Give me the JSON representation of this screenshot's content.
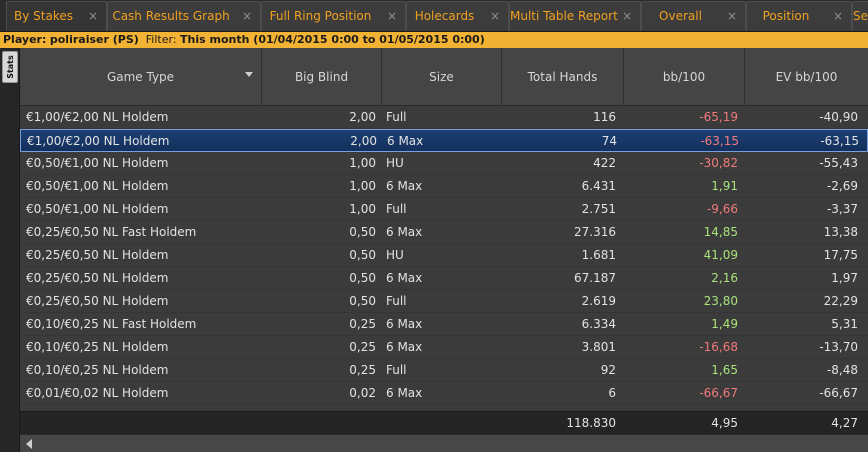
{
  "tabs": [
    {
      "label": "By Stakes",
      "close": "×"
    },
    {
      "label": "Cash Results Graph",
      "close": "×"
    },
    {
      "label": "Full Ring Position",
      "close": "×"
    },
    {
      "label": "Holecards",
      "close": "×"
    },
    {
      "label": "Multi Table Report",
      "close": "×"
    },
    {
      "label": "Overall",
      "close": "×"
    },
    {
      "label": "Position",
      "close": "×"
    },
    {
      "label": "Se",
      "close": ""
    }
  ],
  "filter": {
    "player_label": "Player:",
    "player_value": "poliraiser (PS)",
    "filter_label": "Filter:",
    "filter_value": "This month (01/04/2015 0:00 to 01/05/2015 0:00)"
  },
  "side_tab": "Stats",
  "columns": [
    "Game Type",
    "Big Blind",
    "Size",
    "Total Hands",
    "bb/100",
    "EV bb/100"
  ],
  "rows": [
    {
      "game": "€1,00/€2,00 NL Holdem",
      "bb": "2,00",
      "size": "Full",
      "hands": "116",
      "bb100": "-65,19",
      "ev": "-40,90",
      "sign": "neg"
    },
    {
      "game": "€1,00/€2,00 NL Holdem",
      "bb": "2,00",
      "size": "6 Max",
      "hands": "74",
      "bb100": "-63,15",
      "ev": "-63,15",
      "sign": "neg"
    },
    {
      "game": "€0,50/€1,00 NL Holdem",
      "bb": "1,00",
      "size": "HU",
      "hands": "422",
      "bb100": "-30,82",
      "ev": "-55,43",
      "sign": "neg"
    },
    {
      "game": "€0,50/€1,00 NL Holdem",
      "bb": "1,00",
      "size": "6 Max",
      "hands": "6.431",
      "bb100": "1,91",
      "ev": "-2,69",
      "sign": "pos"
    },
    {
      "game": "€0,50/€1,00 NL Holdem",
      "bb": "1,00",
      "size": "Full",
      "hands": "2.751",
      "bb100": "-9,66",
      "ev": "-3,37",
      "sign": "neg"
    },
    {
      "game": "€0,25/€0,50 NL Fast Holdem",
      "bb": "0,50",
      "size": "6 Max",
      "hands": "27.316",
      "bb100": "14,85",
      "ev": "13,38",
      "sign": "pos"
    },
    {
      "game": "€0,25/€0,50 NL Holdem",
      "bb": "0,50",
      "size": "HU",
      "hands": "1.681",
      "bb100": "41,09",
      "ev": "17,75",
      "sign": "pos"
    },
    {
      "game": "€0,25/€0,50 NL Holdem",
      "bb": "0,50",
      "size": "6 Max",
      "hands": "67.187",
      "bb100": "2,16",
      "ev": "1,97",
      "sign": "pos"
    },
    {
      "game": "€0,25/€0,50 NL Holdem",
      "bb": "0,50",
      "size": "Full",
      "hands": "2.619",
      "bb100": "23,80",
      "ev": "22,29",
      "sign": "pos"
    },
    {
      "game": "€0,10/€0,25 NL Fast Holdem",
      "bb": "0,25",
      "size": "6 Max",
      "hands": "6.334",
      "bb100": "1,49",
      "ev": "5,31",
      "sign": "pos"
    },
    {
      "game": "€0,10/€0,25 NL Holdem",
      "bb": "0,25",
      "size": "6 Max",
      "hands": "3.801",
      "bb100": "-16,68",
      "ev": "-13,70",
      "sign": "neg"
    },
    {
      "game": "€0,10/€0,25 NL Holdem",
      "bb": "0,25",
      "size": "Full",
      "hands": "92",
      "bb100": "1,65",
      "ev": "-8,48",
      "sign": "pos"
    },
    {
      "game": "€0,01/€0,02 NL Holdem",
      "bb": "0,02",
      "size": "6 Max",
      "hands": "6",
      "bb100": "-66,67",
      "ev": "-66,67",
      "sign": "neg"
    }
  ],
  "selected_row": 1,
  "totals": {
    "hands": "118.830",
    "bb100": "4,95",
    "ev": "4,27"
  },
  "colors": {
    "accent": "#f0a020",
    "filter_bg": "#f2b233",
    "negative": "#f07a7a",
    "positive": "#a8e27a",
    "selected": "#1d3f74"
  }
}
